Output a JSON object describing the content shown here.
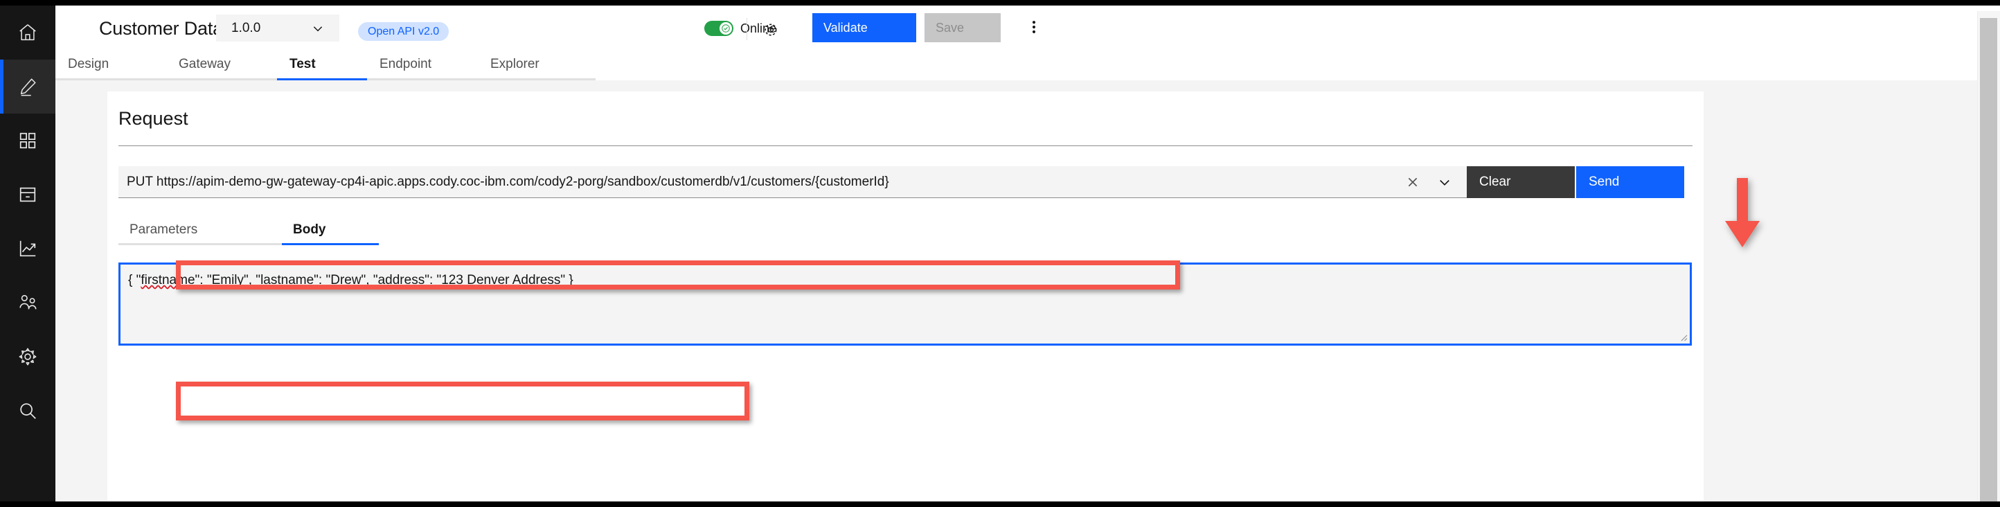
{
  "sidebar": {
    "items": [
      {
        "name": "home",
        "icon": "home-icon",
        "active": false
      },
      {
        "name": "design",
        "icon": "pencil-icon",
        "active": true
      },
      {
        "name": "apps",
        "icon": "grid-icon",
        "active": false
      },
      {
        "name": "catalog",
        "icon": "drawer-icon",
        "active": false
      },
      {
        "name": "analytics",
        "icon": "chart-line-icon",
        "active": false
      },
      {
        "name": "members",
        "icon": "users-icon",
        "active": false
      },
      {
        "name": "settings",
        "icon": "gear-icon",
        "active": false
      },
      {
        "name": "search",
        "icon": "search-icon",
        "active": false
      }
    ]
  },
  "header": {
    "title": "Customer Database",
    "version": "1.0.0",
    "api_tag": "Open API v2.0",
    "online_label": "Online",
    "online_state": "on",
    "validate_label": "Validate",
    "save_label": "Save",
    "save_disabled": true
  },
  "tabs": [
    {
      "label": "Design",
      "active": false
    },
    {
      "label": "Gateway",
      "active": false
    },
    {
      "label": "Test",
      "active": true
    },
    {
      "label": "Endpoint",
      "active": false
    },
    {
      "label": "Explorer",
      "active": false
    }
  ],
  "request": {
    "title": "Request",
    "url_value": "PUT https://apim-demo-gw-gateway-cp4i-apic.apps.cody.coc-ibm.com/cody2-porg/sandbox/customerdb/v1/customers/{customerId}",
    "clear_label": "Clear",
    "send_label": "Send",
    "subtabs": [
      {
        "label": "Parameters",
        "active": false
      },
      {
        "label": "Body",
        "active": true
      }
    ],
    "body_parts": {
      "p1": "{ \"",
      "m1": "firstname",
      "p2": "\": \"Emily\", \"",
      "m2": "lastname",
      "p3": "\": \"Drew\", \"address\": \"123 Denver Address\" }"
    },
    "body_value": "{ \"firstname\": \"Emily\", \"lastname\": \"Drew\", \"address\": \"123 Denver Address\" }"
  },
  "annotations": {
    "color": "#f5554a",
    "url_highlight": "PUT request URL highlighted",
    "body_highlight": "Request body JSON highlighted",
    "arrow": "arrow pointing down to Send button"
  },
  "colors": {
    "accent_blue": "#0f62fe",
    "tag_bg": "#d0e2ff",
    "clear_dark": "#393939",
    "toggle_green": "#24a148",
    "disabled_gray": "#c6c6c6",
    "rail_black": "#161616",
    "annotation_red": "#f5554a"
  }
}
